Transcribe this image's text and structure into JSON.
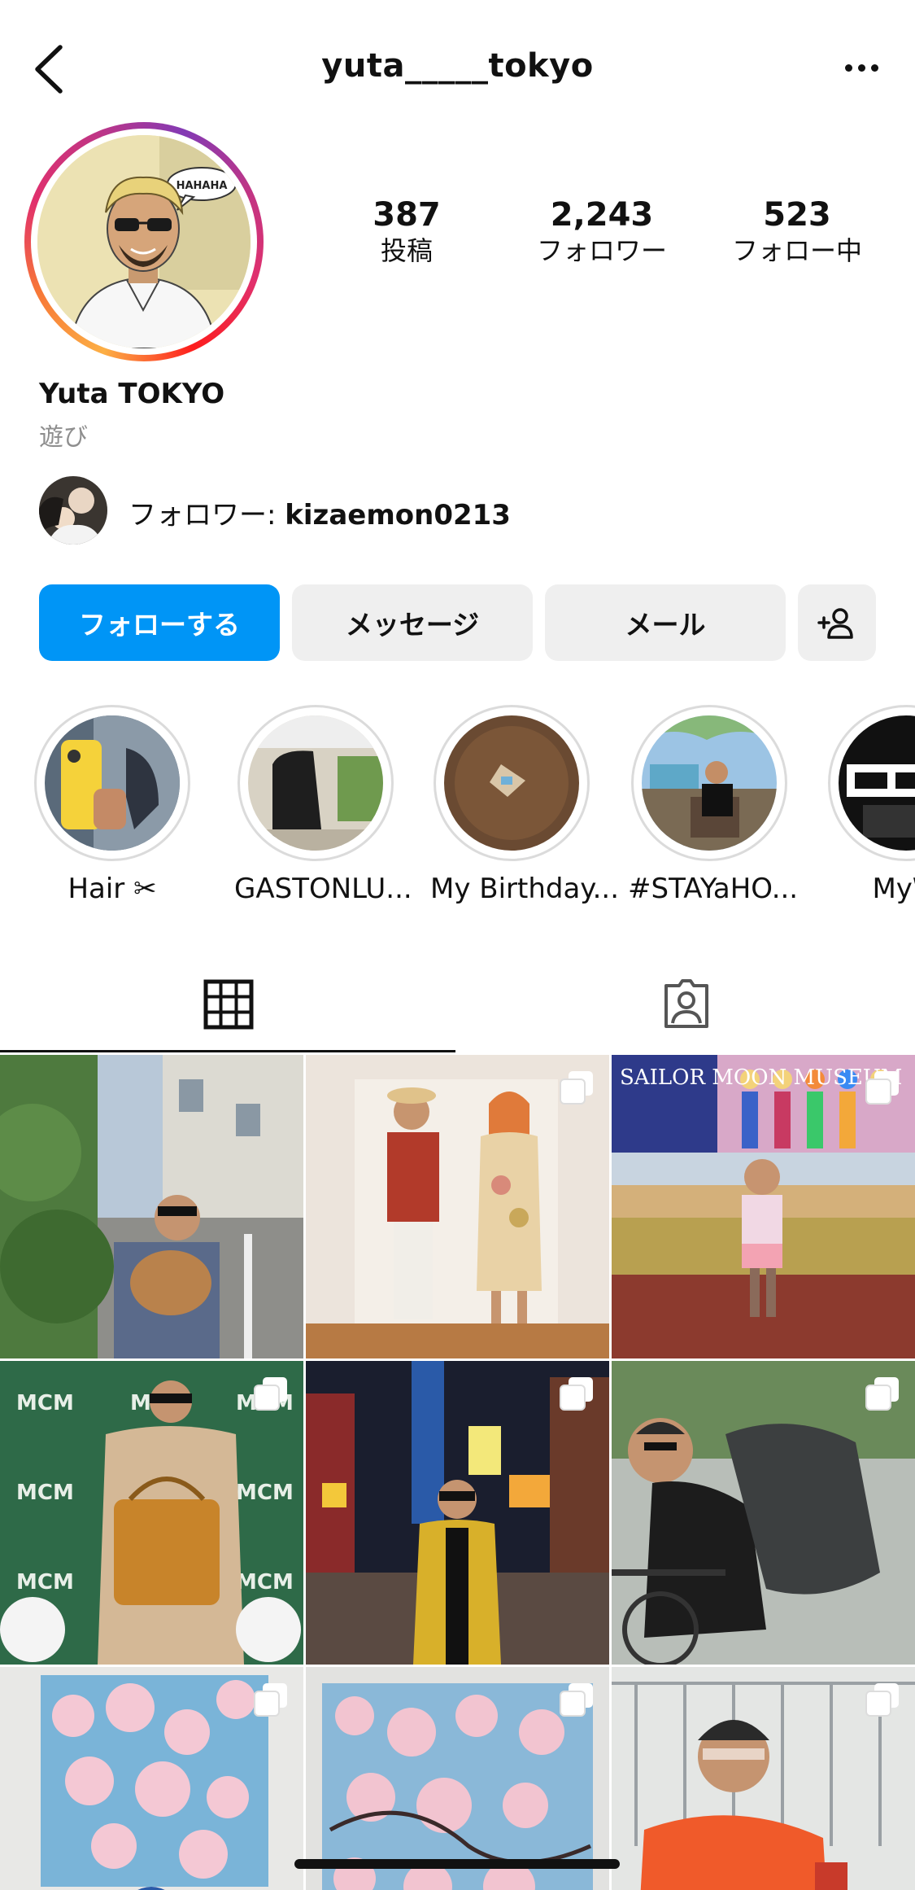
{
  "header": {
    "username": "yuta_____tokyo",
    "back_icon": "chevron-left-icon",
    "more_icon": "more-horizontal-icon"
  },
  "stats": {
    "posts": {
      "value": "387",
      "label": "投稿"
    },
    "followers": {
      "value": "2,243",
      "label": "フォロワー"
    },
    "following": {
      "value": "523",
      "label": "フォロー中"
    }
  },
  "profile": {
    "display_name": "Yuta TOKYO",
    "category": "遊び",
    "avatar_speech": "HAHAHA",
    "followed_by_prefix": "フォロワー: ",
    "followed_by_user": "kizaemon0213"
  },
  "buttons": {
    "follow": "フォローする",
    "message": "メッセージ",
    "email": "メール",
    "suggest_icon": "add-person-icon"
  },
  "highlights": [
    {
      "label": "Hair ✂︎"
    },
    {
      "label": "GASTONLU..."
    },
    {
      "label": "My Birthday..."
    },
    {
      "label": "#STAYaHO..."
    },
    {
      "label": "MyW"
    }
  ],
  "tabs": {
    "grid_icon": "grid-icon",
    "tagged_icon": "tagged-person-icon",
    "active": "grid"
  },
  "grid": {
    "tile_texts": {
      "sailor_moon_title": "SAILOR MOON MUSEUM",
      "mcm_logo": "MCM"
    }
  },
  "colors": {
    "primary": "#0095f6",
    "secondary_button": "#efefef",
    "muted_text": "#8e8e8e"
  }
}
